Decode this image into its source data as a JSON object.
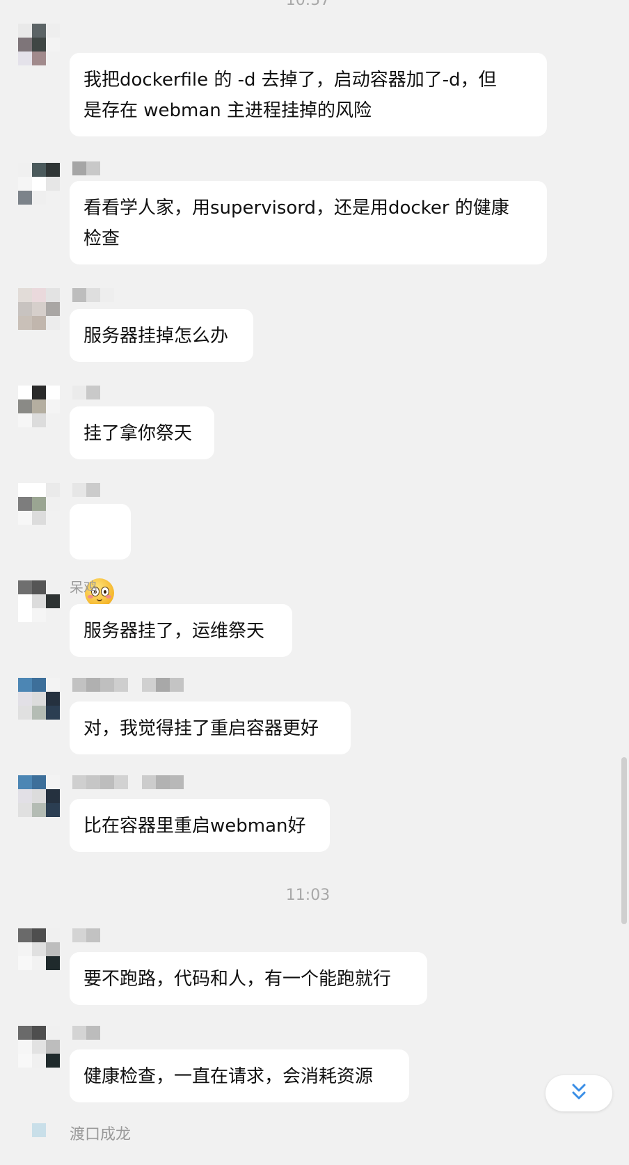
{
  "times": {
    "top": "10:57",
    "middle": "11:03"
  },
  "messages": [
    {
      "text": "我把dockerfile 的 -d 去掉了，启动容器加了-d，但\n是存在 webman 主进程挂掉的风险"
    },
    {
      "text": "看看学人家，用supervisord，还是用docker 的健康\n检查"
    },
    {
      "text": "服务器挂掉怎么办"
    },
    {
      "text": "挂了拿你祭天"
    },
    {
      "emoji": "blush-face-icon"
    },
    {
      "name": "呆鸡",
      "text": "服务器挂了，运维祭天"
    },
    {
      "text": "对，我觉得挂了重启容器更好"
    },
    {
      "text": "比在容器里重启webman好"
    },
    {
      "text": "要不跑路，代码和人，有一个能跑就行"
    },
    {
      "text": "健康检查，一直在请求，会消耗资源"
    }
  ],
  "cutoff_name": "渡口成龙",
  "colors": {
    "background": "#f1f1f1",
    "bubble": "#ffffff",
    "accent": "#3a8ee6"
  },
  "controls": {
    "scroll_to_bottom_icon": "double-chevron-down-icon"
  }
}
